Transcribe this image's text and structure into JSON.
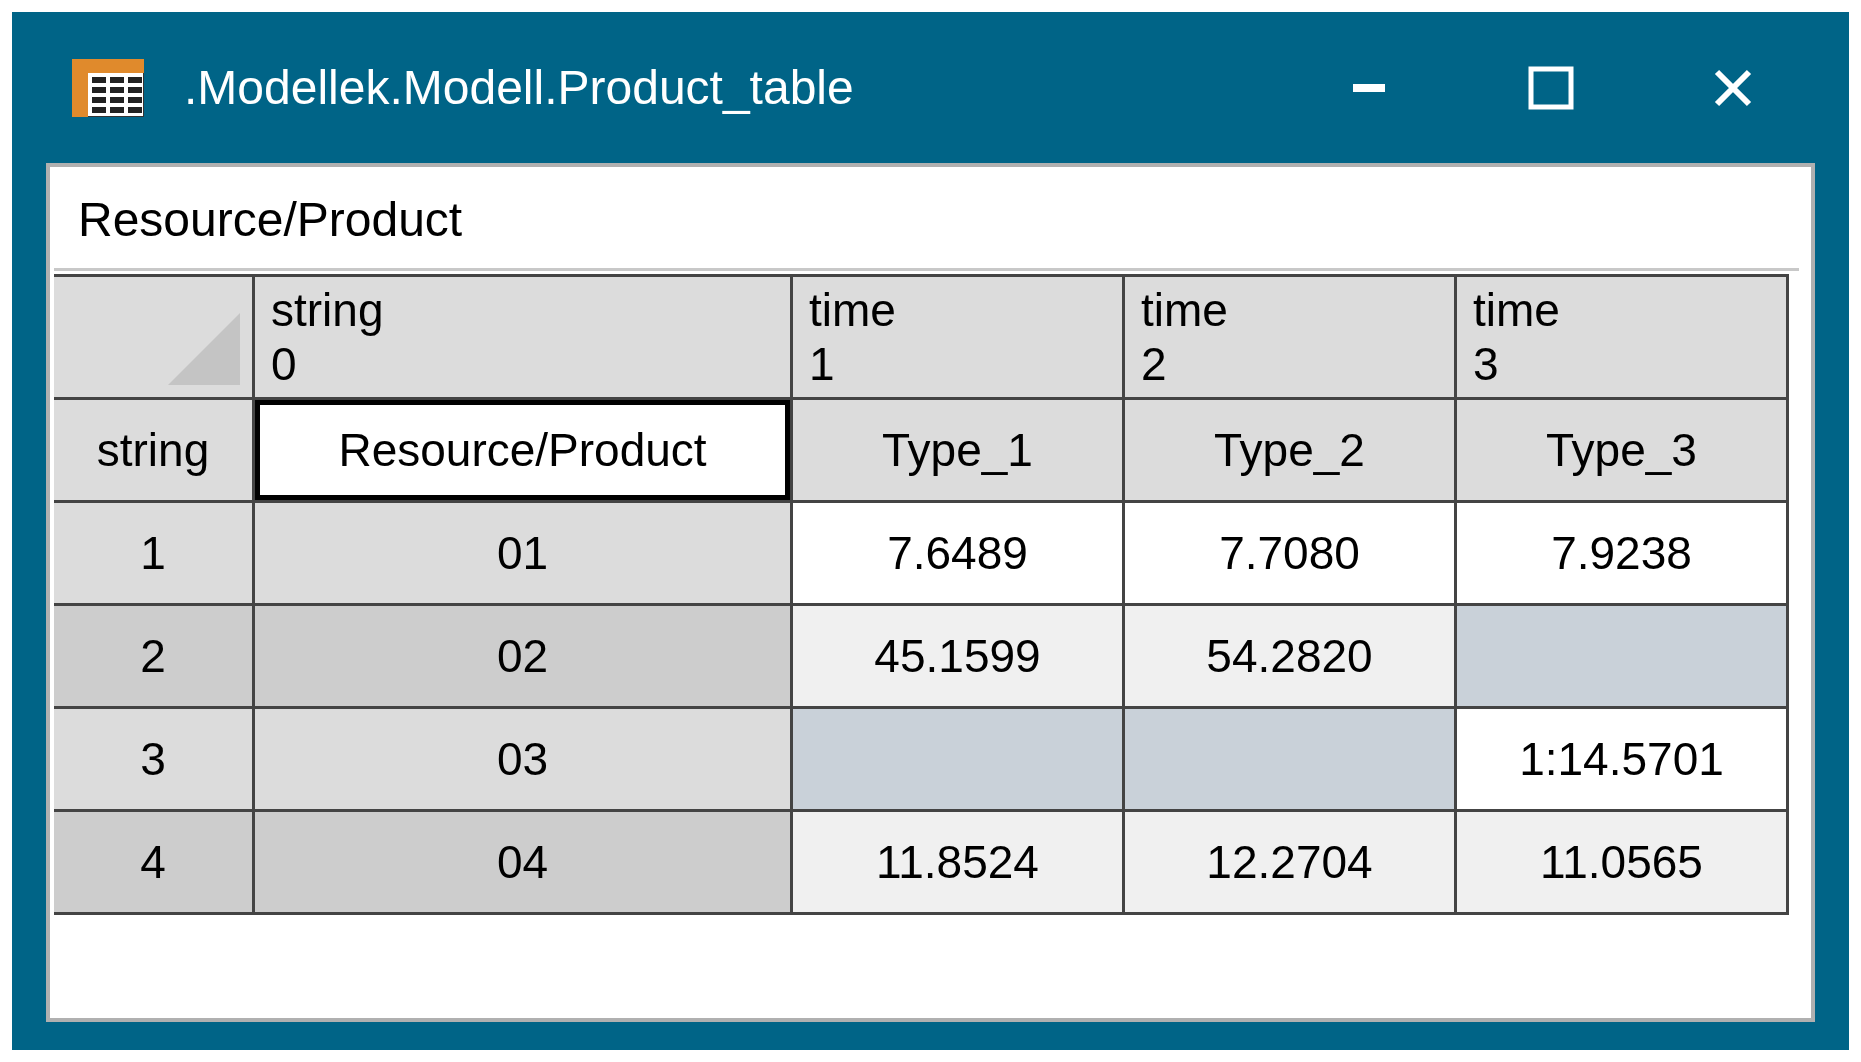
{
  "window": {
    "title": ".Modellek.Modell.Product_table"
  },
  "path_field": {
    "value": "Resource/Product"
  },
  "table": {
    "columns": [
      {
        "type": "string",
        "index": "0"
      },
      {
        "type": "time",
        "index": "1"
      },
      {
        "type": "time",
        "index": "2"
      },
      {
        "type": "time",
        "index": "3"
      }
    ],
    "header_row": {
      "label": "string",
      "cells": [
        {
          "value": "Resource/Product",
          "selected": true
        },
        {
          "value": "Type_1",
          "selected": false
        },
        {
          "value": "Type_2",
          "selected": false
        },
        {
          "value": "Type_3",
          "selected": false
        }
      ]
    },
    "rows": [
      {
        "index": "1",
        "cells": [
          {
            "kind": "value",
            "value": "01"
          },
          {
            "kind": "value",
            "value": "7.6489"
          },
          {
            "kind": "value",
            "value": "7.7080"
          },
          {
            "kind": "value",
            "value": "7.9238"
          }
        ]
      },
      {
        "index": "2",
        "cells": [
          {
            "kind": "value",
            "value": "02"
          },
          {
            "kind": "value",
            "value": "45.1599"
          },
          {
            "kind": "value",
            "value": "54.2820"
          },
          {
            "kind": "empty"
          }
        ]
      },
      {
        "index": "3",
        "cells": [
          {
            "kind": "value",
            "value": "03"
          },
          {
            "kind": "empty"
          },
          {
            "kind": "empty"
          },
          {
            "kind": "value",
            "value": "1:14.5701"
          }
        ]
      },
      {
        "index": "4",
        "cells": [
          {
            "kind": "value",
            "value": "04"
          },
          {
            "kind": "value",
            "value": "11.8524"
          },
          {
            "kind": "value",
            "value": "12.2704"
          },
          {
            "kind": "value",
            "value": "11.0565"
          }
        ]
      }
    ]
  }
}
